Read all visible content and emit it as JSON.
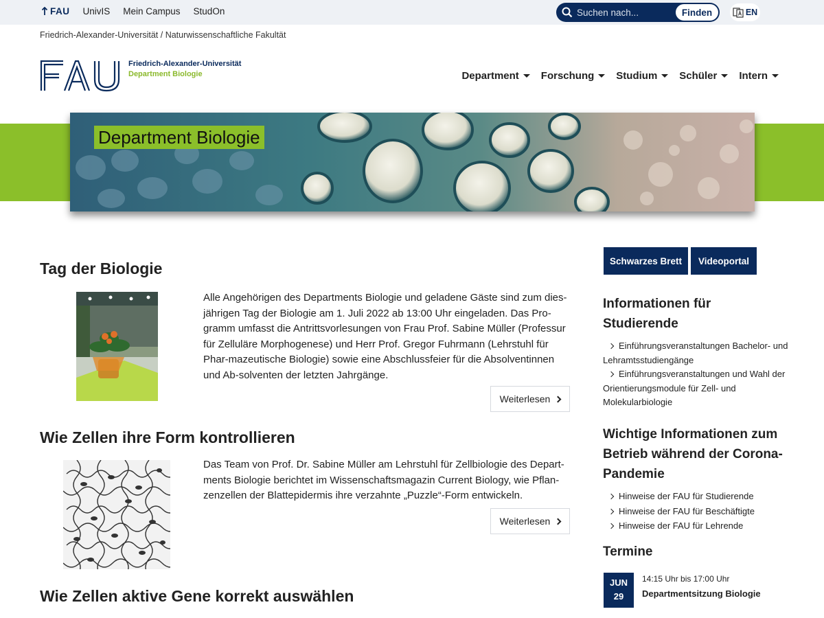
{
  "topbar": {
    "fau_label": "FAU",
    "links": [
      "UnivIS",
      "Mein Campus",
      "StudOn"
    ],
    "search_placeholder": "Suchen nach...",
    "search_button": "Finden",
    "lang": "EN"
  },
  "breadcrumb": "Friedrich-Alexander-Universität / Naturwissenschaftliche Fakultät",
  "logo": {
    "line1": "Friedrich-Alexander-Universität",
    "line2": "Department Biologie"
  },
  "nav": [
    "Department",
    "Forschung",
    "Studium",
    "Schüler",
    "Intern"
  ],
  "hero_title": "Department Biologie",
  "articles": [
    {
      "title": "Tag der Biologie",
      "text": "Alle Angehörigen des Departments Biologie und geladene Gäste sind zum dies-jährigen Tag der Biologie am 1. Juli 2022 ab 13:00 Uhr eingeladen. Das Pro-gramm umfasst die Antrittsvorlesungen von Frau Prof. Sabine Müller (Professur für Zelluläre Morphogenese) und Herr Prof. Gregor Fuhrmann (Lehrstuhl für Phar-mazeutische Biologie) sowie eine Abschlussfeier für die Absolventinnen und Ab-solventen der letzten Jahrgänge.",
      "more": "Weiterlesen"
    },
    {
      "title": "Wie Zellen ihre Form kontrollieren",
      "text": "Das Team von Prof. Dr. Sabine Müller am Lehrstuhl für Zellbiologie des Depart-ments Biologie berichtet im Wissenschaftsmagazin Current Biology, wie Pflan-zenzellen der Blattepidermis ihre verzahnte „Puzzle“-Form entwickeln.",
      "more": "Weiterlesen"
    },
    {
      "title": "Wie Zellen aktive Gene korrekt auswählen"
    }
  ],
  "sidebar": {
    "buttons": [
      "Schwarzes Brett",
      "Videoportal"
    ],
    "info_title": "Informationen für Studierende",
    "info_links": [
      "Einführungsveranstaltungen Bachelor- und Lehramtsstudiengänge",
      "Einführungsveranstaltungen und Wahl der Orientierungsmodule für Zell- und Molekularbiologie"
    ],
    "corona_title": "Wichtige Informationen zum Betrieb während der Corona-Pandemie",
    "corona_links": [
      "Hinweise der FAU für Studierende",
      "Hinweise der FAU für Beschäftigte",
      "Hinweise der FAU für Lehrende"
    ],
    "termine_title": "Termine",
    "event": {
      "month": "JUN",
      "day": "29",
      "time": "14:15 Uhr bis 17:00 Uhr",
      "title": "Departmentsitzung Biologie"
    }
  },
  "colors": {
    "brand_blue": "#0a2a5c",
    "brand_green": "#8bbf2a"
  }
}
